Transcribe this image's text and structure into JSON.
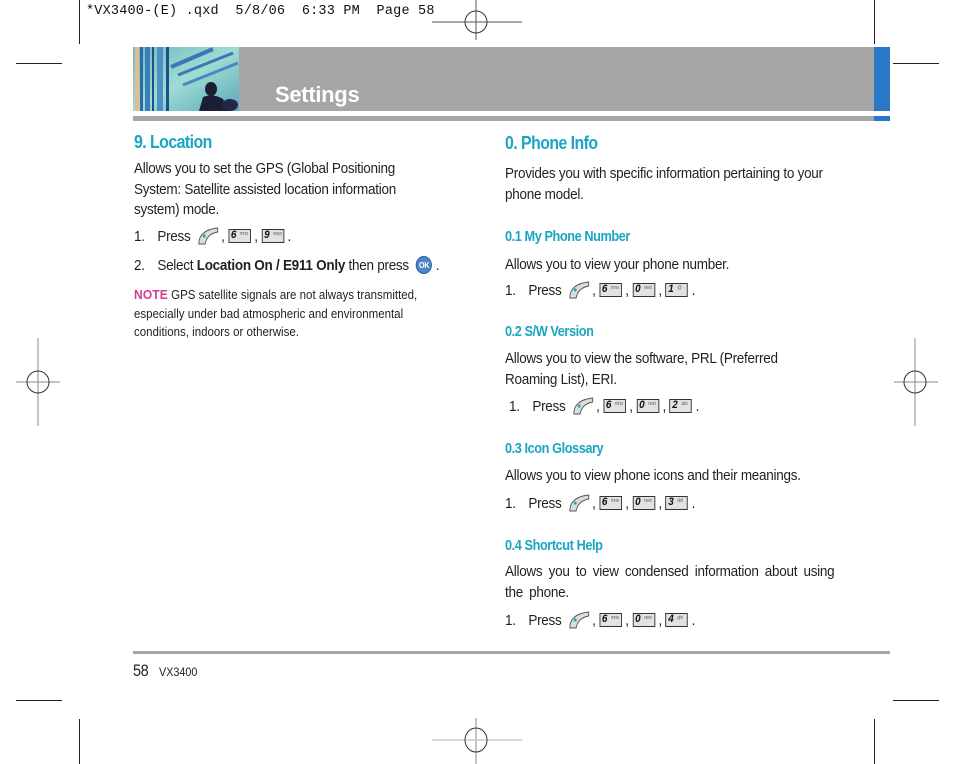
{
  "slug": "*VX3400-(E) .qxd  5/8/06  6:33 PM  Page 58",
  "header": {
    "title": "Settings"
  },
  "left_column": {
    "heading": "9. Location",
    "description": "Allows you to set the GPS (Global Positioning System: Satellite assisted location information system) mode.",
    "steps": [
      {
        "num": "1.",
        "press": "Press",
        "keys": [
          {
            "type": "soft",
            "icon": "menu-soft-key-icon"
          },
          {
            "type": "num",
            "digit": "6",
            "letters": "mno"
          },
          {
            "type": "num",
            "digit": "9",
            "letters": "wxyz"
          }
        ]
      },
      {
        "num": "2.",
        "pre": "Select",
        "option_a": "Location On",
        "sep": " / ",
        "option_b": "E911 Only",
        "post": "then press",
        "ok_label": "OK"
      }
    ],
    "note": {
      "label": "NOTE",
      "text": "GPS satellite signals are not always transmitted, especially under bad atmospheric and environmental conditions, indoors or otherwise."
    }
  },
  "right_column": {
    "heading": "0. Phone Info",
    "description": "Provides you with specific information pertaining to your phone model.",
    "sections": [
      {
        "heading": "0.1 My Phone Number",
        "description": "Allows you to view your phone number.",
        "step_num": "1.",
        "press": "Press",
        "keys": [
          {
            "digit": "6",
            "letters": "mno"
          },
          {
            "digit": "0",
            "letters": "next"
          },
          {
            "digit": "1",
            "letters": "@"
          }
        ]
      },
      {
        "heading": "0.2 S/W Version",
        "description": "Allows you to view the software, PRL (Preferred Roaming List), ERI.",
        "step_num": "1.",
        "press": "Press",
        "keys": [
          {
            "digit": "6",
            "letters": "mno"
          },
          {
            "digit": "0",
            "letters": "next"
          },
          {
            "digit": "2",
            "letters": "abc"
          }
        ]
      },
      {
        "heading": "0.3 Icon Glossary",
        "description": "Allows you to view phone icons and their meanings.",
        "step_num": "1.",
        "press": "Press",
        "keys": [
          {
            "digit": "6",
            "letters": "mno"
          },
          {
            "digit": "0",
            "letters": "next"
          },
          {
            "digit": "3",
            "letters": "def"
          }
        ]
      },
      {
        "heading": "0.4 Shortcut Help",
        "description": "Allows you to view condensed information about using the phone.",
        "step_num": "1.",
        "press": "Press",
        "keys": [
          {
            "digit": "6",
            "letters": "mno"
          },
          {
            "digit": "0",
            "letters": "next"
          },
          {
            "digit": "4",
            "letters": "ghi"
          }
        ]
      }
    ]
  },
  "footer": {
    "page_number": "58",
    "model": "VX3400"
  },
  "colors": {
    "heading": "#1ba5c3",
    "header_gray": "#a7a5a5",
    "header_blue": "#2a78c8",
    "note": "#d63a8f"
  }
}
